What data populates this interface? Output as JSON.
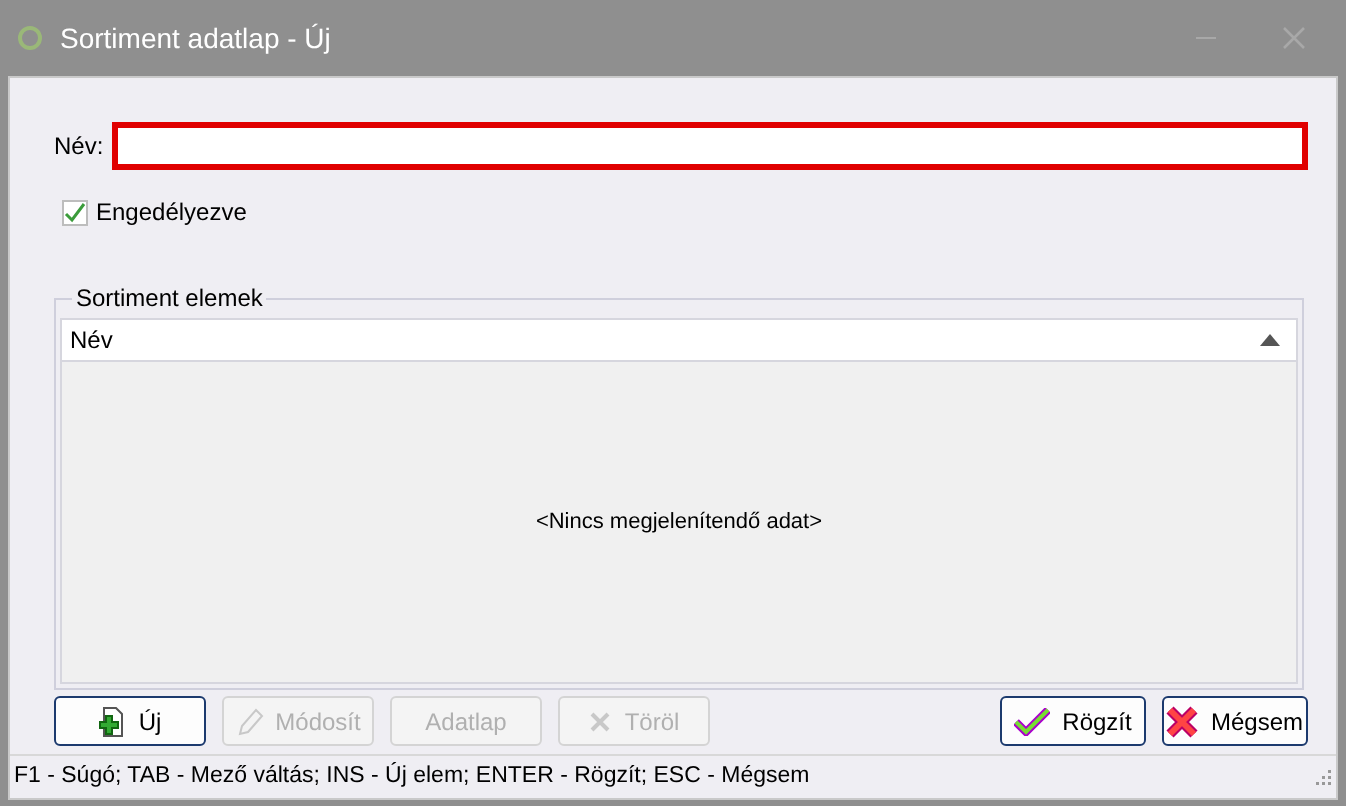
{
  "window": {
    "title": "Sortiment adatlap - Új"
  },
  "name_field": {
    "label": "Név:"
  },
  "enabled_checkbox": {
    "label": "Engedélyezve",
    "checked": true
  },
  "group": {
    "title": "Sortiment elemek",
    "table": {
      "columns": [
        {
          "label": "Név",
          "sorted_ascending": true
        }
      ],
      "empty_text": "<Nincs megjelenítendő adat>"
    }
  },
  "left_buttons": [
    {
      "label": "Új",
      "kind": "new",
      "disabled": false
    },
    {
      "label": "Módosít",
      "kind": "edit",
      "disabled": true
    },
    {
      "label": "Adatlap",
      "kind": "sheet",
      "disabled": true
    },
    {
      "label": "Töröl",
      "kind": "delete",
      "disabled": true
    }
  ],
  "right_buttons": [
    {
      "label": "Rögzít",
      "kind": "save",
      "disabled": false
    },
    {
      "label": "Mégsem",
      "kind": "cancel",
      "disabled": false
    }
  ],
  "status_bar": "F1 - Súgó; TAB - Mező váltás; INS - Új elem; ENTER - Rögzít; ESC - Mégsem"
}
